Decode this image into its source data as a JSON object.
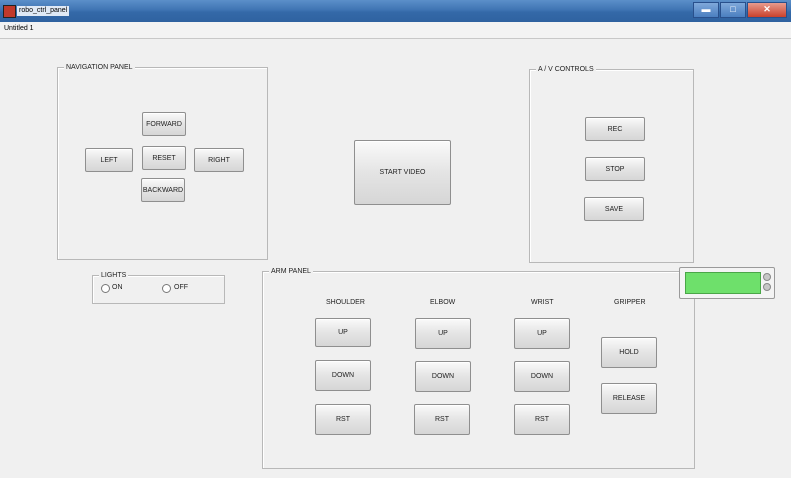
{
  "window": {
    "title": "robo_ctrl_panel",
    "min": "▬",
    "max": "□",
    "close": "✕"
  },
  "menubar": {
    "doc_tab": "Untitled 1"
  },
  "navigation": {
    "title": "NAVIGATION PANEL",
    "forward": "FORWARD",
    "left": "LEFT",
    "reset": "RESET",
    "right": "RIGHT",
    "backward": "BACKWARD"
  },
  "video": {
    "start": "START VIDEO"
  },
  "av": {
    "title": "A / V CONTROLS",
    "rec": "REC",
    "stop": "STOP",
    "save": "SAVE"
  },
  "lights": {
    "title": "LIGHTS",
    "on": "ON",
    "off": "OFF"
  },
  "arm": {
    "title": "ARM PANEL",
    "shoulder": {
      "label": "SHOULDER",
      "up": "UP",
      "down": "DOWN",
      "rst": "RST"
    },
    "elbow": {
      "label": "ELBOW",
      "up": "UP",
      "down": "DOWN",
      "rst": "RST"
    },
    "wrist": {
      "label": "WRIST",
      "up": "UP",
      "down": "DOWN",
      "rst": "RST"
    },
    "gripper": {
      "label": "GRIPPER",
      "hold": "HOLD",
      "release": "RELEASE"
    }
  },
  "colors": {
    "status_green": "#6ee06b",
    "titlebar": "#3f74b3"
  }
}
